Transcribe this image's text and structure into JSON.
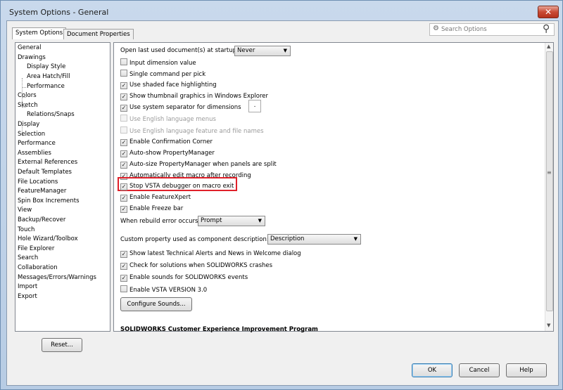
{
  "window": {
    "title": "System Options - General",
    "close_label": "✕"
  },
  "tabs": [
    {
      "label": "System Options"
    },
    {
      "label": "Document Properties"
    }
  ],
  "search": {
    "placeholder": "Search Options"
  },
  "tree": {
    "items": [
      "General",
      "Drawings",
      "Display Style",
      "Area Hatch/Fill",
      "Performance",
      "Colors",
      "Sketch",
      "Relations/Snaps",
      "Display",
      "Selection",
      "Performance",
      "Assemblies",
      "External References",
      "Default Templates",
      "File Locations",
      "FeatureManager",
      "Spin Box Increments",
      "View",
      "Backup/Recover",
      "Touch",
      "Hole Wizard/Toolbox",
      "File Explorer",
      "Search",
      "Collaboration",
      "Messages/Errors/Warnings",
      "Import",
      "Export"
    ]
  },
  "options": {
    "startup_label": "Open last used document(s) at startup:",
    "startup_value": "Never",
    "checkboxes": [
      {
        "label": "Input dimension value",
        "checked": false,
        "mark": ""
      },
      {
        "label": "Single command per pick",
        "checked": false,
        "mark": ""
      },
      {
        "label": "Use shaded face highlighting",
        "checked": true,
        "mark": "✓"
      },
      {
        "label": "Show thumbnail graphics in Windows Explorer",
        "checked": true,
        "mark": "✓"
      },
      {
        "label": "Use system separator for dimensions",
        "checked": true,
        "mark": "✓"
      },
      {
        "label": "Use English language menus",
        "checked": false,
        "mark": ""
      },
      {
        "label": "Use English language feature and file names",
        "checked": false,
        "mark": ""
      },
      {
        "label": "Enable Confirmation Corner",
        "checked": true,
        "mark": "✓"
      },
      {
        "label": "Auto-show PropertyManager",
        "checked": true,
        "mark": "✓"
      },
      {
        "label": "Auto-size PropertyManager when panels are split",
        "checked": true,
        "mark": "✓"
      },
      {
        "label": "Automatically edit macro after recording",
        "checked": true,
        "mark": "✓"
      },
      {
        "label": "Stop VSTA debugger on macro exit",
        "checked": true,
        "mark": "✓"
      },
      {
        "label": "Enable FeatureXpert",
        "checked": true,
        "mark": "✓"
      },
      {
        "label": "Enable Freeze bar",
        "checked": true,
        "mark": "✓"
      }
    ],
    "separator_value": ".",
    "rebuild_label": "When rebuild error occurs:",
    "rebuild_value": "Prompt",
    "custom_prop_label": "Custom property used as component description:",
    "custom_prop_value": "Description",
    "checkboxes2": [
      {
        "label": "Show latest Technical Alerts and News in Welcome dialog",
        "checked": true,
        "mark": "✓"
      },
      {
        "label": "Check for solutions when SOLIDWORKS crashes",
        "checked": true,
        "mark": "✓"
      },
      {
        "label": "Enable sounds for SOLIDWORKS events",
        "checked": true,
        "mark": "✓"
      },
      {
        "label": "Enable VSTA VERSION 3.0",
        "checked": false,
        "mark": ""
      }
    ],
    "configure_sounds_label": "Configure Sounds...",
    "ceip_heading": "SOLIDWORKS Customer Experience Improvement Program"
  },
  "buttons": {
    "reset": "Reset...",
    "ok": "OK",
    "cancel": "Cancel",
    "help": "Help"
  },
  "colors": {
    "highlight_border": "#e0202a",
    "ok_focus": "#3c7fb1"
  }
}
